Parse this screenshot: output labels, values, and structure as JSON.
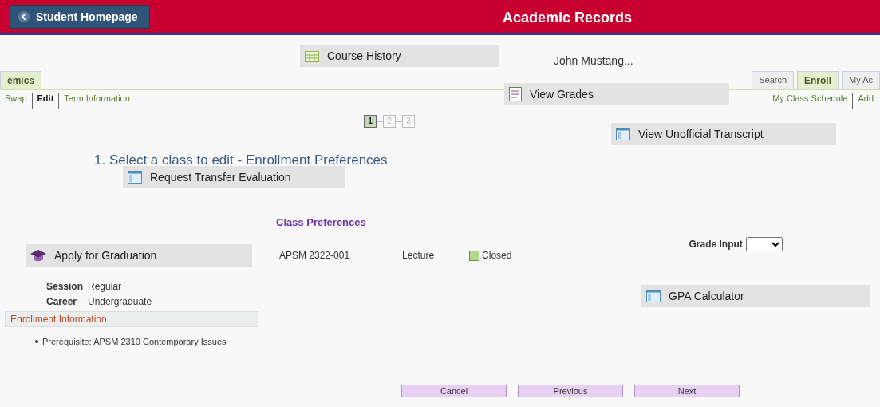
{
  "header": {
    "back_button": "Student Homepage",
    "title": "Academic Records"
  },
  "user_name": "John Mustang...",
  "left_tab": {
    "label": "emics",
    "selected": true
  },
  "tabs": [
    {
      "label": "Search",
      "selected": false
    },
    {
      "label": "Enroll",
      "selected": true
    },
    {
      "label": "My Ac",
      "selected": false
    }
  ],
  "breadcrumb": [
    {
      "label": "Swap",
      "selected": false
    },
    {
      "label": "Edit",
      "selected": true
    },
    {
      "label": "Term Information",
      "selected": false
    }
  ],
  "right_links": [
    "My Class Schedule",
    "Add"
  ],
  "steps": [
    {
      "label": "1",
      "selected": true
    },
    {
      "label": "2",
      "selected": false
    },
    {
      "label": "3",
      "selected": false
    }
  ],
  "heading": "1.  Select a class to edit - Enrollment Preferences",
  "section_title": "Class Preferences",
  "class_row": {
    "class": "APSM 2322-001",
    "component": "Lecture",
    "status": "Closed"
  },
  "grade_input": {
    "label": "Grade Input"
  },
  "details": [
    {
      "label": "Session",
      "value": "Regular"
    },
    {
      "label": "Career",
      "value": "Undergraduate"
    }
  ],
  "enrollment_info": {
    "title": "Enrollment Information",
    "items": [
      "Prerequisite: APSM 2310 Contemporary Issues"
    ]
  },
  "buttons": [
    "Cancel",
    "Previous",
    "Next"
  ],
  "menu": [
    {
      "label": "Course History",
      "kind": "history"
    },
    {
      "label": "View Grades",
      "kind": "grades"
    },
    {
      "label": "View Unofficial Transcript",
      "kind": "window"
    },
    {
      "label": "Request Transfer Evaluation",
      "kind": "window"
    },
    {
      "label": "Apply for Graduation",
      "kind": "cap"
    },
    {
      "label": "GPA Calculator",
      "kind": "window"
    }
  ]
}
